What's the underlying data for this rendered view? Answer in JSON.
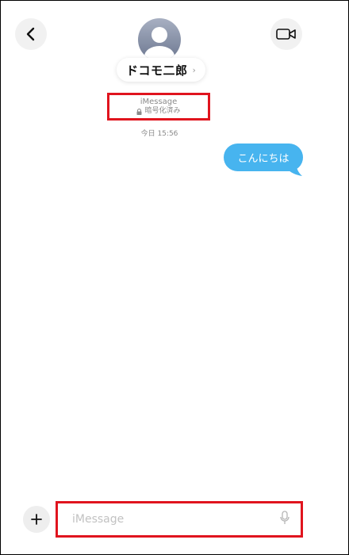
{
  "header": {
    "contact_name": "ドコモ二郎",
    "chevron": "›"
  },
  "conversation": {
    "service": "iMessage",
    "encryption": "暗号化済み",
    "timestamp": "今日 15:56",
    "messages": [
      {
        "text": "こんにちは",
        "direction": "outgoing"
      }
    ]
  },
  "composer": {
    "placeholder": "iMessage"
  },
  "colors": {
    "bubble": "#47b4ef",
    "highlight": "#e0141e"
  },
  "icons": {
    "back": "back-chevron-icon",
    "video": "video-camera-icon",
    "avatar": "person-silhouette-icon",
    "lock": "lock-icon",
    "plus": "plus-icon",
    "mic": "microphone-icon"
  }
}
